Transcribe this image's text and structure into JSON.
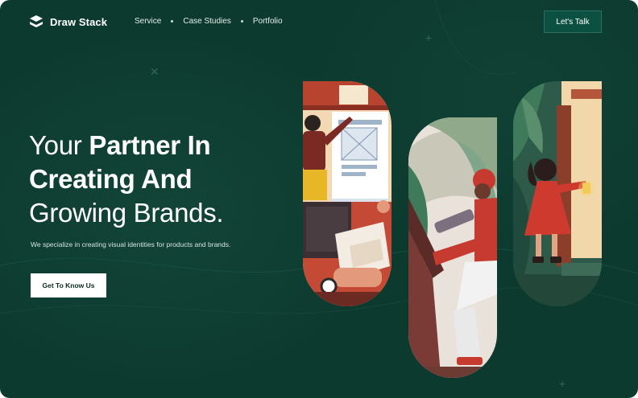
{
  "brand": {
    "name": "Draw Stack",
    "logo_icon": "layers-icon"
  },
  "nav": {
    "links": [
      "Service",
      "Case Studies",
      "Portfolio"
    ],
    "cta_label": "Let's Talk"
  },
  "hero": {
    "headline_line1_light": "Your ",
    "headline_line1_bold": "Partner In",
    "headline_line2_bold": "Creating And",
    "headline_line3_light": "Growing Brands.",
    "subtitle": "We specialize in creating visual identities for products and brands.",
    "button_label": "Get To Know Us"
  },
  "illustrations": [
    {
      "name": "designer-at-whiteboard-illustration"
    },
    {
      "name": "artist-with-tablet-illustration"
    },
    {
      "name": "girl-with-lantern-illustration"
    }
  ],
  "colors": {
    "background": "#0d3a2f",
    "accent_button": "#0b5041",
    "primary_button": "#ffffff",
    "text": "#ffffff"
  }
}
